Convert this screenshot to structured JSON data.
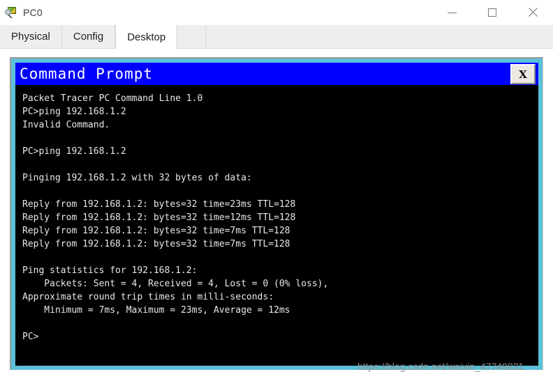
{
  "window": {
    "title": "PC0",
    "icon": "pc-device-icon",
    "controls": {
      "minimize": "minimize-icon",
      "maximize": "maximize-icon",
      "close": "close-icon"
    }
  },
  "tabs": [
    {
      "label": "Physical",
      "active": false
    },
    {
      "label": "Config",
      "active": false
    },
    {
      "label": "Desktop",
      "active": true
    }
  ],
  "terminal": {
    "title": "Command Prompt",
    "close_label": "X",
    "colors": {
      "titlebar": "#0000ff",
      "body": "#000000",
      "text": "#e8e8e8",
      "frame": "#5bc0d8"
    },
    "lines": [
      "Packet Tracer PC Command Line 1.0",
      "PC>ping 192.168.1.2",
      "Invalid Command.",
      "",
      "PC>ping 192.168.1.2",
      "",
      "Pinging 192.168.1.2 with 32 bytes of data:",
      "",
      "Reply from 192.168.1.2: bytes=32 time=23ms TTL=128",
      "Reply from 192.168.1.2: bytes=32 time=12ms TTL=128",
      "Reply from 192.168.1.2: bytes=32 time=7ms TTL=128",
      "Reply from 192.168.1.2: bytes=32 time=7ms TTL=128",
      "",
      "Ping statistics for 192.168.1.2:",
      "    Packets: Sent = 4, Received = 4, Lost = 0 (0% loss),",
      "Approximate round trip times in milli-seconds:",
      "    Minimum = 7ms, Maximum = 23ms, Average = 12ms",
      "",
      "PC>"
    ]
  },
  "watermark": {
    "text": "https://blog.csdn.net/weixin_47749831"
  }
}
